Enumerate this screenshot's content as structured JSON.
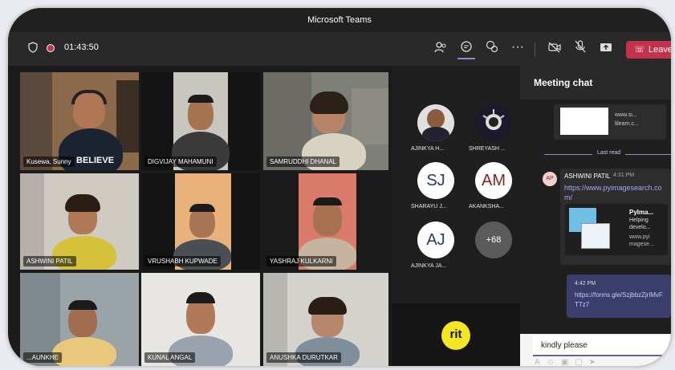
{
  "window": {
    "title": "Microsoft Teams"
  },
  "toolbar": {
    "timer": "01:43:50",
    "leave_label": "Leave"
  },
  "tiles": [
    {
      "name": "Kusewa, Sunny",
      "shirt_text": "BELIEVE"
    },
    {
      "name": "DIGVIJAY MAHAMUNI"
    },
    {
      "name": "SAMRUDDHI DHANAL"
    },
    {
      "name": "ASHWINI PATIL"
    },
    {
      "name": "VRUSHABH KUPWADE"
    },
    {
      "name": "YASHRAJ KULKARNI"
    },
    {
      "name": "...AUNKHE"
    },
    {
      "name": "KUNAL ANGAL"
    },
    {
      "name": "ANUSHKA DURUTKAR"
    }
  ],
  "side_participants": [
    {
      "name": "AJINKYA H...",
      "initials": ""
    },
    {
      "name": "SHREYASH ...",
      "initials": ""
    },
    {
      "name": "SHARAYU J...",
      "initials": "SJ"
    },
    {
      "name": "AKANKSHA...",
      "initials": "AM"
    },
    {
      "name": "AJINKYA JA...",
      "initials": "AJ"
    },
    {
      "name": "",
      "initials": "+68"
    }
  ],
  "side_logo": "rit",
  "chat": {
    "title": "Meeting chat",
    "top_card_lines": [
      "www.si...",
      "lilearn.c..."
    ],
    "last_read": "Last read",
    "msg1": {
      "avatar": "AP",
      "sender": "ASHWINI PATIL",
      "time": "4:31 PM",
      "link": "https://www.pyimagesearch.com/"
    },
    "preview": {
      "title": "PyIma...",
      "desc1": "Helping",
      "desc2": "develo...",
      "url1": "www.pyi",
      "url2": "magese..."
    },
    "msg2": {
      "time": "4:42 PM",
      "link": "https://forms.gle/SzjbbzZjriMvFTTz7"
    },
    "input_value": "kindly please"
  }
}
